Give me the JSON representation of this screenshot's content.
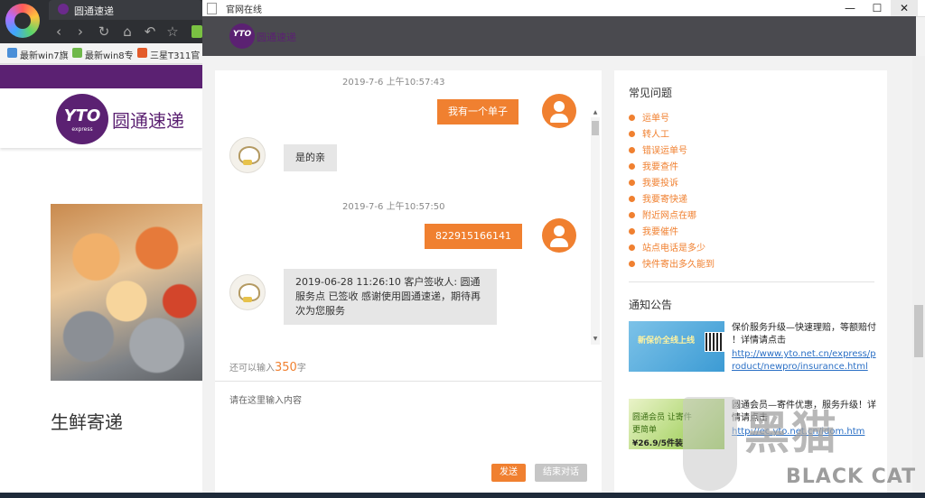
{
  "browser": {
    "tab_title": "圆通速递",
    "nav_icons": [
      "back-icon",
      "forward-icon",
      "reload-icon",
      "home-icon",
      "undo-icon",
      "bookmark-star-icon"
    ],
    "bookmarks": [
      "最新win7旗",
      "最新win8专",
      "三星T311官"
    ]
  },
  "background_page": {
    "logo_mark": "YTO",
    "logo_sub": "express",
    "logo_text": "圆通速递",
    "caption": "生鲜寄递"
  },
  "window": {
    "title": "官网在线",
    "buttons": [
      "—",
      "☐",
      "✕"
    ]
  },
  "chat": {
    "header_logo_mark": "YTO",
    "header_logo_text": "圆通速递",
    "messages": [
      {
        "time": "2019-7-6 上午10:57:43",
        "from": "user",
        "text": "我有一个单子"
      },
      {
        "from": "agent",
        "text": "是的亲"
      },
      {
        "time": "2019-7-6 上午10:57:50",
        "from": "user",
        "text": "822915166141"
      },
      {
        "from": "agent",
        "text": "2019-06-28 11:26:10 客户签收人: 圆通服务点 已签收 感谢使用圆通速递，期待再次为您服务"
      }
    ],
    "counter_prefix": "还可以输入",
    "counter_value": "350",
    "counter_suffix": "字",
    "input_placeholder": "请在这里输入内容",
    "send_label": "发送",
    "end_label": "结束对话"
  },
  "sidebar": {
    "faq_title": "常见问题",
    "faq_items": [
      "运单号",
      "转人工",
      "错误运单号",
      "我要查件",
      "我要投诉",
      "我要寄快递",
      "附近网点在哪",
      "我要催件",
      "站点电话是多少",
      "快件寄出多久能到"
    ],
    "notice_title": "通知公告",
    "notices": [
      {
        "image_text": "新保价全线上线",
        "text": "保价服务升级—快速理赔，等额赔付 ！详情请点击",
        "link": "http://www.yto.net.cn/express/product/newpro/insurance.html"
      },
      {
        "image_text": "圆通会员 让寄件更简单",
        "image_price": "¥26.9/5件装",
        "text": "圆通会员—寄件优惠，服务升级！详情请点击",
        "link": "http://ec.yto.net.cn/idom.htm"
      }
    ]
  },
  "watermark": {
    "cn": "黑猫",
    "en": "BLACK CAT"
  },
  "colors": {
    "accent": "#f08030",
    "brand": "#5b2172",
    "header": "#4a4a4f"
  }
}
